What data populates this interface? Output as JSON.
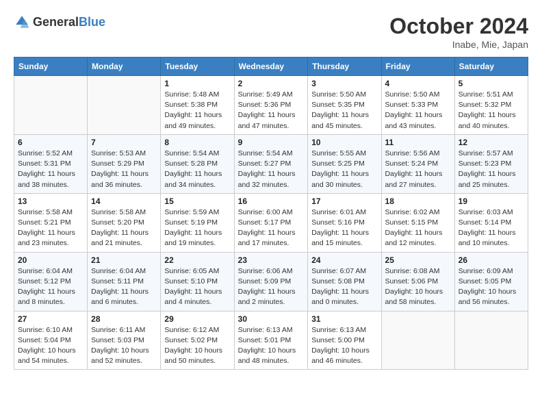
{
  "logo": {
    "text_general": "General",
    "text_blue": "Blue"
  },
  "title": {
    "month": "October 2024",
    "location": "Inabe, Mie, Japan"
  },
  "weekdays": [
    "Sunday",
    "Monday",
    "Tuesday",
    "Wednesday",
    "Thursday",
    "Friday",
    "Saturday"
  ],
  "weeks": [
    [
      {
        "day": "",
        "empty": true
      },
      {
        "day": "",
        "empty": true
      },
      {
        "day": "1",
        "sunrise": "5:48 AM",
        "sunset": "5:38 PM",
        "daylight": "11 hours and 49 minutes."
      },
      {
        "day": "2",
        "sunrise": "5:49 AM",
        "sunset": "5:36 PM",
        "daylight": "11 hours and 47 minutes."
      },
      {
        "day": "3",
        "sunrise": "5:50 AM",
        "sunset": "5:35 PM",
        "daylight": "11 hours and 45 minutes."
      },
      {
        "day": "4",
        "sunrise": "5:50 AM",
        "sunset": "5:33 PM",
        "daylight": "11 hours and 43 minutes."
      },
      {
        "day": "5",
        "sunrise": "5:51 AM",
        "sunset": "5:32 PM",
        "daylight": "11 hours and 40 minutes."
      }
    ],
    [
      {
        "day": "6",
        "sunrise": "5:52 AM",
        "sunset": "5:31 PM",
        "daylight": "11 hours and 38 minutes."
      },
      {
        "day": "7",
        "sunrise": "5:53 AM",
        "sunset": "5:29 PM",
        "daylight": "11 hours and 36 minutes."
      },
      {
        "day": "8",
        "sunrise": "5:54 AM",
        "sunset": "5:28 PM",
        "daylight": "11 hours and 34 minutes."
      },
      {
        "day": "9",
        "sunrise": "5:54 AM",
        "sunset": "5:27 PM",
        "daylight": "11 hours and 32 minutes."
      },
      {
        "day": "10",
        "sunrise": "5:55 AM",
        "sunset": "5:25 PM",
        "daylight": "11 hours and 30 minutes."
      },
      {
        "day": "11",
        "sunrise": "5:56 AM",
        "sunset": "5:24 PM",
        "daylight": "11 hours and 27 minutes."
      },
      {
        "day": "12",
        "sunrise": "5:57 AM",
        "sunset": "5:23 PM",
        "daylight": "11 hours and 25 minutes."
      }
    ],
    [
      {
        "day": "13",
        "sunrise": "5:58 AM",
        "sunset": "5:21 PM",
        "daylight": "11 hours and 23 minutes."
      },
      {
        "day": "14",
        "sunrise": "5:58 AM",
        "sunset": "5:20 PM",
        "daylight": "11 hours and 21 minutes."
      },
      {
        "day": "15",
        "sunrise": "5:59 AM",
        "sunset": "5:19 PM",
        "daylight": "11 hours and 19 minutes."
      },
      {
        "day": "16",
        "sunrise": "6:00 AM",
        "sunset": "5:17 PM",
        "daylight": "11 hours and 17 minutes."
      },
      {
        "day": "17",
        "sunrise": "6:01 AM",
        "sunset": "5:16 PM",
        "daylight": "11 hours and 15 minutes."
      },
      {
        "day": "18",
        "sunrise": "6:02 AM",
        "sunset": "5:15 PM",
        "daylight": "11 hours and 12 minutes."
      },
      {
        "day": "19",
        "sunrise": "6:03 AM",
        "sunset": "5:14 PM",
        "daylight": "11 hours and 10 minutes."
      }
    ],
    [
      {
        "day": "20",
        "sunrise": "6:04 AM",
        "sunset": "5:12 PM",
        "daylight": "11 hours and 8 minutes."
      },
      {
        "day": "21",
        "sunrise": "6:04 AM",
        "sunset": "5:11 PM",
        "daylight": "11 hours and 6 minutes."
      },
      {
        "day": "22",
        "sunrise": "6:05 AM",
        "sunset": "5:10 PM",
        "daylight": "11 hours and 4 minutes."
      },
      {
        "day": "23",
        "sunrise": "6:06 AM",
        "sunset": "5:09 PM",
        "daylight": "11 hours and 2 minutes."
      },
      {
        "day": "24",
        "sunrise": "6:07 AM",
        "sunset": "5:08 PM",
        "daylight": "11 hours and 0 minutes."
      },
      {
        "day": "25",
        "sunrise": "6:08 AM",
        "sunset": "5:06 PM",
        "daylight": "10 hours and 58 minutes."
      },
      {
        "day": "26",
        "sunrise": "6:09 AM",
        "sunset": "5:05 PM",
        "daylight": "10 hours and 56 minutes."
      }
    ],
    [
      {
        "day": "27",
        "sunrise": "6:10 AM",
        "sunset": "5:04 PM",
        "daylight": "10 hours and 54 minutes."
      },
      {
        "day": "28",
        "sunrise": "6:11 AM",
        "sunset": "5:03 PM",
        "daylight": "10 hours and 52 minutes."
      },
      {
        "day": "29",
        "sunrise": "6:12 AM",
        "sunset": "5:02 PM",
        "daylight": "10 hours and 50 minutes."
      },
      {
        "day": "30",
        "sunrise": "6:13 AM",
        "sunset": "5:01 PM",
        "daylight": "10 hours and 48 minutes."
      },
      {
        "day": "31",
        "sunrise": "6:13 AM",
        "sunset": "5:00 PM",
        "daylight": "10 hours and 46 minutes."
      },
      {
        "day": "",
        "empty": true
      },
      {
        "day": "",
        "empty": true
      }
    ]
  ]
}
